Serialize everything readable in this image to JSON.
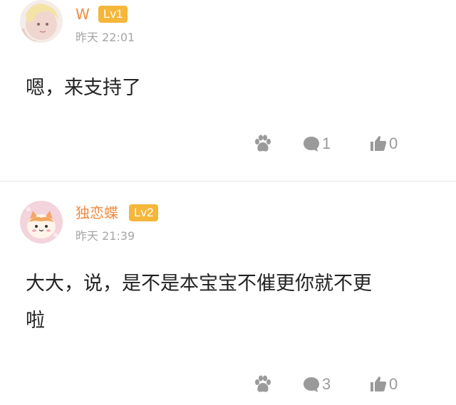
{
  "comments": [
    {
      "username": "W",
      "level": "Lv1",
      "time": "昨天 22:01",
      "content": "嗯，来支持了",
      "reply_count": "1",
      "like_count": "0"
    },
    {
      "username": "独恋蝶",
      "level": "Lv2",
      "time": "昨天 21:39",
      "content": "大大，说，是不是本宝宝不催更你就不更\n啦",
      "reply_count": "3",
      "like_count": "0"
    }
  ],
  "icons": {
    "reward": "paw-icon",
    "reply": "comment-bubble-icon",
    "like": "thumbs-up-icon"
  },
  "colors": {
    "username": "#f08a3e",
    "level_badge": "#f5b63a",
    "meta_text": "#a6a6a6",
    "icon": "#9a9a9a"
  }
}
